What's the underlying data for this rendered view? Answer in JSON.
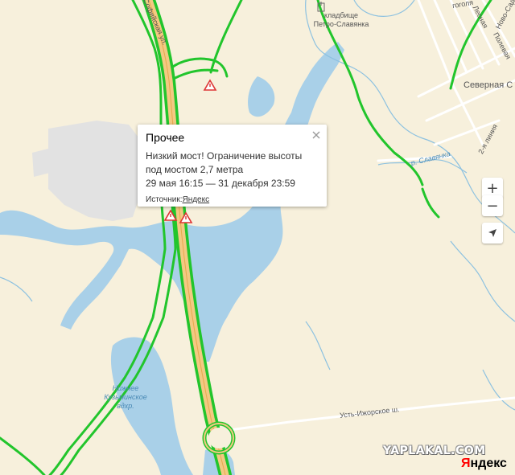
{
  "map": {
    "labels": {
      "cemetery": "кладбище\nПетро-Славянка",
      "north": "Северная С",
      "river": "р. Славянка",
      "reservoir": "Нижнее\nКузьминское\nвдхр.",
      "road_izhorskoe": "Усть-Ижорское ш.",
      "street_gogolya": "гоголя",
      "street_novo": "Ново-Садо",
      "street_lesnaya": "Лесная",
      "street_polevaya": "Полевая",
      "street_2ya": "2-я линия",
      "highway_name": "Софийская ул."
    },
    "colors": {
      "land": "#f7f0dc",
      "water": "#a9d0e8",
      "traffic_green": "#22c52c",
      "highway_fill": "#f3c983",
      "industrial": "#e6e6e6"
    }
  },
  "popup": {
    "title": "Прочее",
    "description": "Низкий мост! Ограничение высоты под мостом 2,7 метра",
    "time": "29 мая 16:15 — 31 декабря 23:59",
    "source_label": "Источник:",
    "source_link": "Яндекс"
  },
  "controls": {
    "zoom_in": "+",
    "zoom_out": "−",
    "locate_icon": "navigation-arrow-icon"
  },
  "watermarks": {
    "yaplakal": "YAPLAKAL.COM",
    "yandex_first": "Я",
    "yandex_rest": "ндекс"
  }
}
